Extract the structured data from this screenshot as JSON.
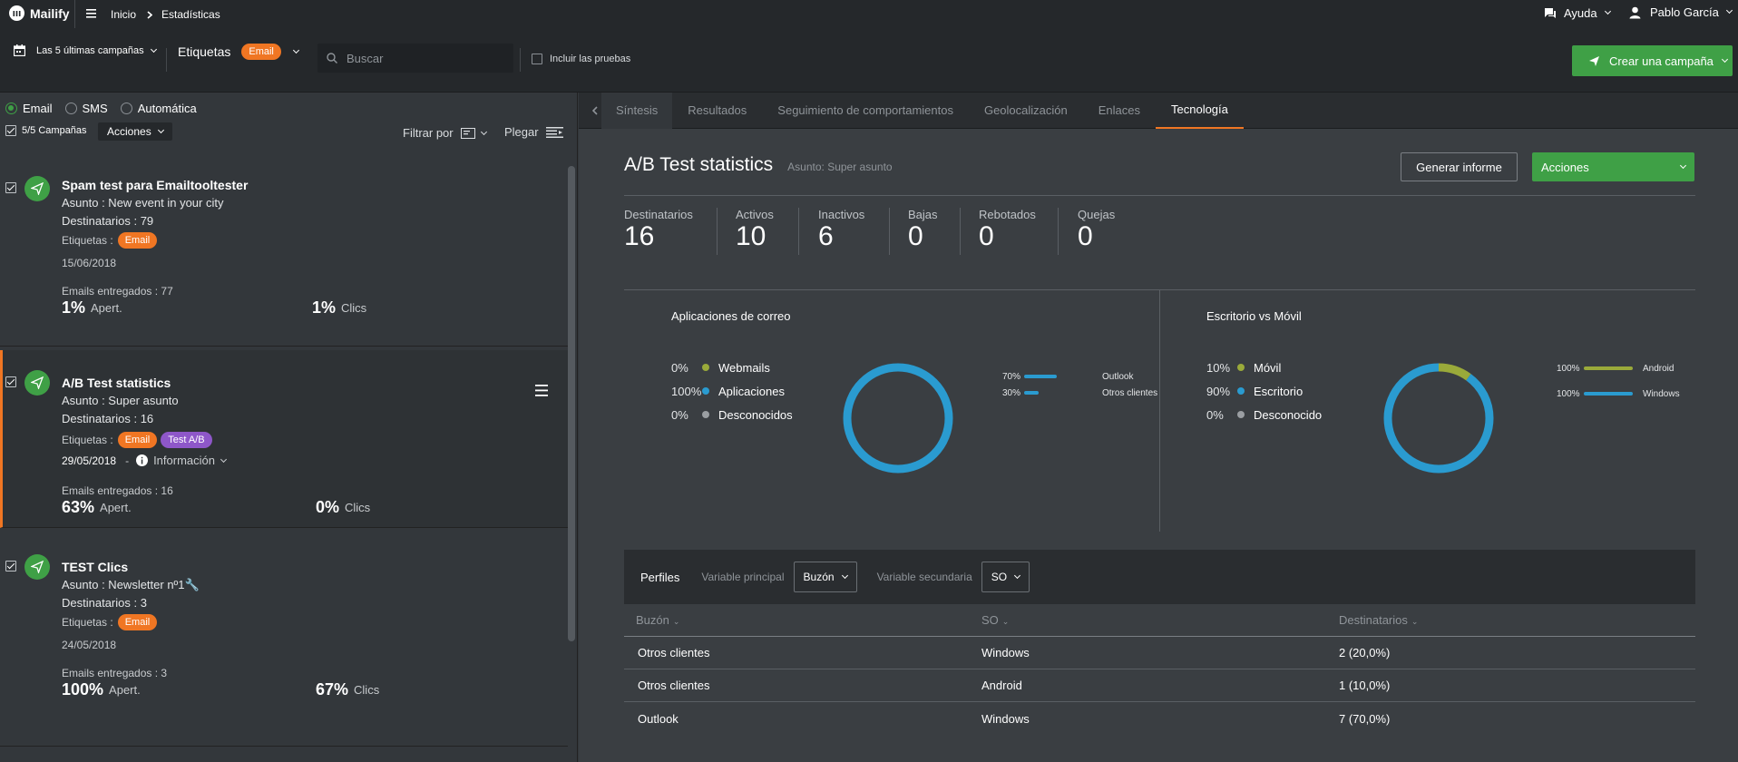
{
  "app": {
    "name": "Mailify"
  },
  "breadcrumb": {
    "home": "Inicio",
    "current": "Estadísticas"
  },
  "topbar": {
    "help": "Ayuda",
    "user": "Pablo García"
  },
  "filters": {
    "campaign_range": "Las 5 últimas campañas",
    "tags_label": "Etiquetas",
    "tag_selected": "Email",
    "search_placeholder": "Buscar",
    "include_tests": "Incluir las pruebas",
    "create_button": "Crear una campaña"
  },
  "channels": {
    "email": "Email",
    "sms": "SMS",
    "auto": "Automática"
  },
  "list_header": {
    "count": "5/5 Campañas",
    "actions": "Acciones",
    "filter_by": "Filtrar por",
    "fold": "Plegar"
  },
  "campaigns": [
    {
      "title": "Spam test para Emailtooltester",
      "subject": "Asunto : New event in your city",
      "recipients": "Destinatarios : 79",
      "tags_label": "Etiquetas :",
      "tags": [
        "Email"
      ],
      "date": "15/06/2018",
      "delivered": "Emails entregados : 77",
      "open_pct": "1%",
      "open_label": "Apert.",
      "click_pct": "1%",
      "click_label": "Clics"
    },
    {
      "title": "A/B Test statistics",
      "subject": "Asunto : Super asunto",
      "recipients": "Destinatarios : 16",
      "tags_label": "Etiquetas :",
      "tags": [
        "Email",
        "Test A/B"
      ],
      "date": "29/05/2018",
      "info": "Información",
      "delivered": "Emails entregados : 16",
      "open_pct": "63%",
      "open_label": "Apert.",
      "click_pct": "0%",
      "click_label": "Clics"
    },
    {
      "title": "TEST Clics",
      "subject": "Asunto : Newsletter nº1🔧",
      "recipients": "Destinatarios : 3",
      "tags_label": "Etiquetas :",
      "tags": [
        "Email"
      ],
      "date": "24/05/2018",
      "delivered": "Emails entregados : 3",
      "open_pct": "100%",
      "open_label": "Apert.",
      "click_pct": "67%",
      "click_label": "Clics"
    }
  ],
  "tabs": [
    "Síntesis",
    "Resultados",
    "Seguimiento de comportamientos",
    "Geolocalización",
    "Enlaces",
    "Tecnología"
  ],
  "report": {
    "title": "A/B Test statistics",
    "subject": "Asunto: Super asunto",
    "generate": "Generar informe",
    "actions": "Acciones"
  },
  "stats": [
    {
      "label": "Destinatarios",
      "value": "16"
    },
    {
      "label": "Activos",
      "value": "10"
    },
    {
      "label": "Inactivos",
      "value": "6"
    },
    {
      "label": "Bajas",
      "value": "0"
    },
    {
      "label": "Rebotados",
      "value": "0"
    },
    {
      "label": "Quejas",
      "value": "0"
    }
  ],
  "mail_apps": {
    "title": "Aplicaciones de correo",
    "legend": [
      {
        "pct": "0%",
        "label": "Webmails",
        "color": "#9aaa3a"
      },
      {
        "pct": "100%",
        "label": "Aplicaciones",
        "color": "#2a9bd0"
      },
      {
        "pct": "0%",
        "label": "Desconocidos",
        "color": "#9a9ea2"
      }
    ],
    "donut": [
      0,
      100,
      0
    ],
    "bars": [
      {
        "pct": "70%",
        "label": "Outlook",
        "value": 0.7
      },
      {
        "pct": "30%",
        "label": "Otros clientes",
        "value": 0.3
      }
    ]
  },
  "desktop_mobile": {
    "title": "Escritorio vs Móvil",
    "legend": [
      {
        "pct": "10%",
        "label": "Móvil",
        "color": "#9aaa3a"
      },
      {
        "pct": "90%",
        "label": "Escritorio",
        "color": "#2a9bd0"
      },
      {
        "pct": "0%",
        "label": "Desconocido",
        "color": "#9a9ea2"
      }
    ],
    "donut": [
      10,
      90,
      0
    ],
    "bars": [
      {
        "pct": "100%",
        "label": "Android",
        "value": 1,
        "color": "#9aaa3a"
      },
      {
        "pct": "100%",
        "label": "Windows",
        "value": 1,
        "color": "#2a9bd0"
      }
    ]
  },
  "profiles": {
    "title": "Perfiles",
    "primary_label": "Variable principal",
    "primary_value": "Buzón",
    "secondary_label": "Variable secundaria",
    "secondary_value": "SO",
    "columns": [
      "Buzón",
      "SO",
      "Destinatarios"
    ],
    "rows": [
      [
        "Otros clientes",
        "Windows",
        "2 (20,0%)"
      ],
      [
        "Otros clientes",
        "Android",
        "1 (10,0%)"
      ],
      [
        "Outlook",
        "Windows",
        "7 (70,0%)"
      ]
    ]
  }
}
